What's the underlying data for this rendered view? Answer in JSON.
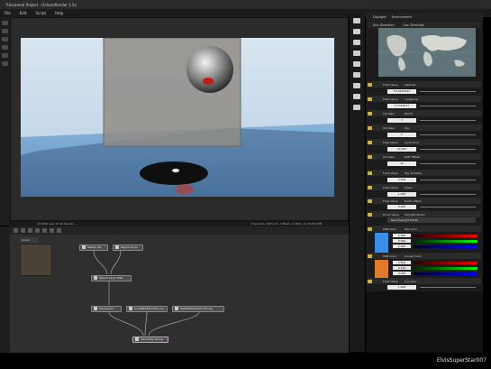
{
  "window": {
    "title": "*Unnamed Project - OctaneRender 1.5x"
  },
  "menu": [
    "File",
    "Edit",
    "Script",
    "Help"
  ],
  "status": {
    "left": "2d 0000 spp, 0h 00 Render ...",
    "right": "3 Seconds, 300% Pri, 3 Mesh, 1 GPUs, 11.7/1024 MB"
  },
  "node_editor": {
    "tab": "Scene",
    "nodes": {
      "mesh1": "Mesh1.obj",
      "objlayer": "Object Layer",
      "objlayermap": "Object Layer Map",
      "placement": "Placement",
      "plane": "Sun999999(1234).obj",
      "sphere": "9999999999991234.obj",
      "geogroup": "Geometry Group"
    }
  },
  "panel": {
    "tab1": "Daylight",
    "tab2": "Environment",
    "sun_direction": [
      "Sun Direction",
      "Sun Direction"
    ],
    "params": [
      {
        "type": "Float Value",
        "name": "Latitude",
        "value": "53.6434442"
      },
      {
        "type": "Float Value",
        "name": "Longitude",
        "value": "174.56017"
      },
      {
        "type": "Int Value",
        "name": "Month",
        "value": "7"
      },
      {
        "type": "Int Value",
        "name": "Day",
        "value": "1"
      },
      {
        "type": "Float Value",
        "name": "Local Time",
        "value": "16.000"
      },
      {
        "type": "Int Value",
        "name": "GMT Offset",
        "value": "12"
      },
      {
        "type": "Float Value",
        "name": "Sky Turbidity",
        "value": "2.200"
      },
      {
        "type": "Float Value",
        "name": "Power",
        "value": "1.000"
      },
      {
        "type": "Float Value",
        "name": "North Offset",
        "value": "0.000"
      }
    ],
    "enum": {
      "type": "Enum Value",
      "name": "Daylight Model",
      "value": "New Daylight Model"
    },
    "sky_color": {
      "type": "RGB Color",
      "name": "Sky Color",
      "channels": [
        "0.050",
        "0.300",
        "0.500"
      ],
      "swatch": "#3b8ee8"
    },
    "sunset_color": {
      "type": "RGB Color",
      "name": "Sunset Color",
      "channels": [
        "0.600",
        "0.150",
        "0.020"
      ],
      "swatch": "#e07b2c"
    },
    "sun_size": {
      "type": "Float Value",
      "name": "Sun Size",
      "value": "1.000"
    }
  },
  "watermark": "ElvisSuperStar007",
  "colors": {
    "accent": "#c8b24a",
    "node_selected": "#c9a0d6",
    "sky": "#b9cfe6",
    "floor": "#6d9bc8"
  }
}
